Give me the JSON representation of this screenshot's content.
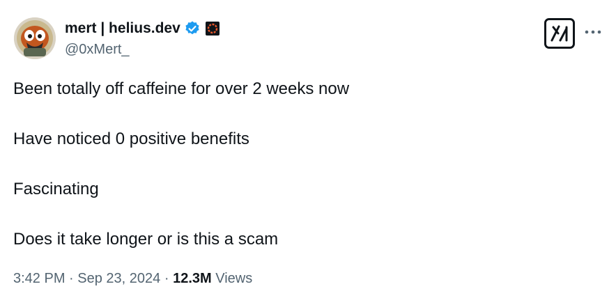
{
  "author": {
    "display_name": "mert | helius.dev",
    "handle": "@0xMert_",
    "avatar_icon": "cartoon-bird-avatar",
    "verified_icon": "verified-badge-icon",
    "verified_color": "#1d9bf0",
    "affiliate_icon": "organization-affiliate-badge-icon"
  },
  "header_actions": {
    "grok_icon": "grok-icon",
    "more_icon": "more-options-icon"
  },
  "tweet": {
    "lines": [
      "Been totally off caffeine for over 2 weeks now",
      "Have noticed 0 positive benefits",
      "Fascinating",
      "Does it take longer or is this a scam"
    ]
  },
  "meta": {
    "time": "3:42 PM",
    "separator": "·",
    "date": "Sep 23, 2024",
    "views_count": "12.3M",
    "views_label": "Views"
  },
  "colors": {
    "text_primary": "#0f1419",
    "text_secondary": "#536471",
    "background": "#ffffff"
  }
}
